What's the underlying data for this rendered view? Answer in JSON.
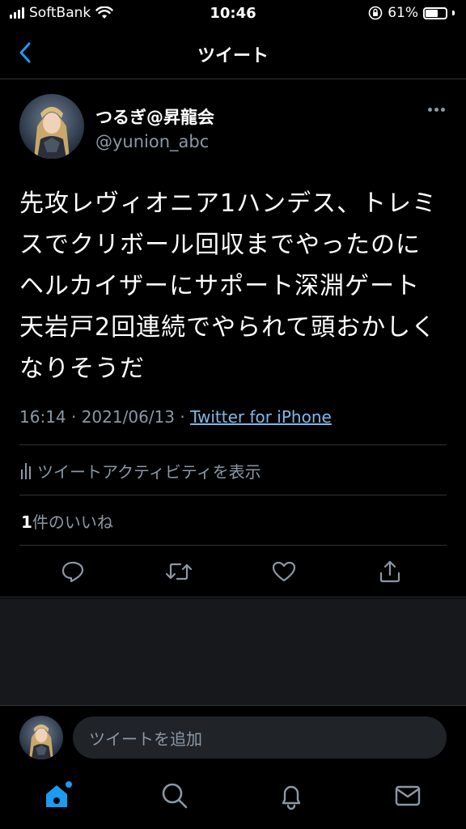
{
  "status_bar": {
    "carrier": "SoftBank",
    "time": "10:46",
    "battery_text": "61%",
    "battery_level": 0.61
  },
  "nav": {
    "title": "ツイート"
  },
  "tweet": {
    "author_name": "つるぎ@昇龍会",
    "author_handle": "@yunion_abc",
    "text_lines": [
      "先攻レヴィオニア1ハンデス、トレミ",
      "スでクリボール回収までやったのに",
      "ヘルカイザーにサポート深淵ゲート",
      "天岩戸2回連続でやられて頭おかしく",
      "なりそうだ"
    ],
    "timestamp": "16:14 · 2021/06/13 · ",
    "source": "Twitter for iPhone",
    "activity_label": "ツイートアクティビティを表示",
    "likes_count": "1",
    "likes_label": "件のいいね"
  },
  "composer": {
    "placeholder": "ツイートを追加"
  },
  "colors": {
    "accent": "#1d9bf0",
    "secondary_text": "#8b98a5",
    "divider": "#2f3336",
    "link": "#7fb8e8"
  },
  "icons": {
    "reply": "reply-icon",
    "retweet": "retweet-icon",
    "like": "heart-icon",
    "share": "share-icon",
    "home": "home-icon",
    "search": "search-icon",
    "notifications": "bell-icon",
    "messages": "mail-icon"
  }
}
